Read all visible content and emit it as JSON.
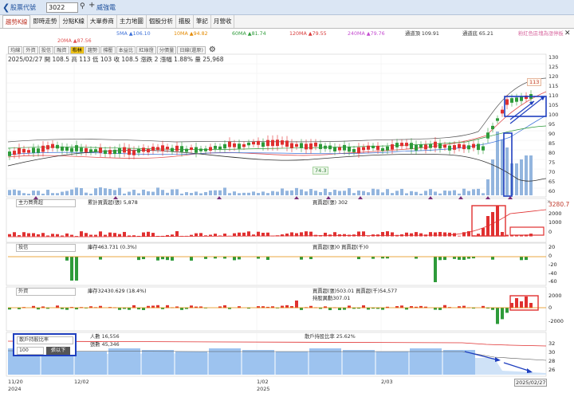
{
  "header": {
    "title": "股票代號",
    "symbol": "3022",
    "company": "威強電"
  },
  "tabs": [
    "趨勢K線",
    "即時走勢",
    "分點K線",
    "大單券商",
    "主力地圖",
    "個股分析",
    "描股",
    "筆記",
    "月營收"
  ],
  "ma": {
    "20ma": "20MA ▲87.56",
    "5ma": "5MA ▲106.10",
    "10ma": "10MA ▲94.82",
    "60ma": "60MA ▲81.74",
    "120ma": "120MA ▲79.55",
    "240ma": "240MA ▲79.76",
    "upper": "通道頂 109.91",
    "lower": "通道底 65.21",
    "note": "粉紅色區塊為漲停板"
  },
  "subtabs": [
    "均線",
    "外資",
    "投信",
    "融資",
    "布林",
    "趨勢",
    "撐壓",
    "本益比",
    "紅綠燈",
    "分價量",
    "日線(還原)"
  ],
  "info": "2025/02/27 開 108.5  高 113  低 103  收 108.5  漲跌 2  漲幅 1.88%  量 25,968",
  "price_axis": [
    "130",
    "125",
    "120",
    "115",
    "110",
    "105",
    "100",
    "95",
    "90",
    "85",
    "80",
    "75",
    "70",
    "65",
    "60"
  ],
  "high_label": "113",
  "low_label": "74.3",
  "panel1": {
    "select": "主力買賣超",
    "cum": "累計買賣超(張) 5,878",
    "val": "買賣超(張) 302",
    "axis": [
      "3280.7",
      "2000",
      "1000",
      "0"
    ]
  },
  "panel2": {
    "select": "投信",
    "cum": "庫存463.731 (0.3%)",
    "val": "買賣超(張)0 買賣超(千)0",
    "axis": [
      "20",
      "0",
      "-20",
      "-40",
      "-60"
    ]
  },
  "panel3": {
    "select": "外資",
    "cum": "庫存32430.629 (18.4%)",
    "val": "買賣超(張)503.01 買賣超(千)54,577",
    "sub": "持股異動307.01",
    "axis": [
      "2000",
      "0",
      "-2000"
    ]
  },
  "panel4": {
    "select": "散戶持股比率",
    "people": "人數 16,556",
    "shares": "張數 45,346",
    "ratio": "散戶持股比率 25.62%",
    "combo": "100",
    "btn": "張以下",
    "axis": [
      "32",
      "30",
      "28",
      "26"
    ]
  },
  "dates": {
    "d1": "11/20",
    "y1": "2024",
    "d2": "12/02",
    "d3": "1/02",
    "y3": "2025",
    "d4": "2/03",
    "d5": "2025/02/27"
  }
}
